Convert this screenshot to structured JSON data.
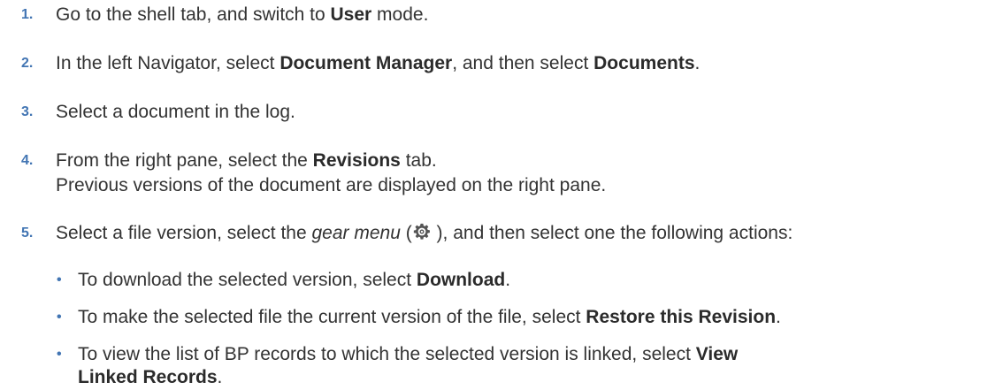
{
  "steps": [
    {
      "num": "1.",
      "p1": "Go to the shell tab, and switch to ",
      "b1": "User",
      "p2": " mode."
    },
    {
      "num": "2.",
      "p1": "In the left Navigator, select ",
      "b1": "Document Manager",
      "p2": ", and then select ",
      "b2": "Documents",
      "p3": "."
    },
    {
      "num": "3.",
      "p1": "Select a document in the log."
    },
    {
      "num": "4.",
      "p1": "From the right pane, select the ",
      "b1": "Revisions",
      "p2": " tab.",
      "line2": "Previous versions of the document are displayed on the right pane."
    },
    {
      "num": "5.",
      "p1": "Select a file version, select the ",
      "i1": "gear menu",
      "p2": " (",
      "p3": " ), and then select one the following actions:"
    }
  ],
  "bullets": [
    {
      "dot": "•",
      "p1": "To download the selected version, select ",
      "b1": "Download",
      "p2": "."
    },
    {
      "dot": "•",
      "p1": "To make the selected file the current version of the file, select ",
      "b1": "Restore this Revision",
      "p2": "."
    },
    {
      "dot": "•",
      "p1": "To view the list of BP records to which the selected version is linked, select ",
      "b1": "View",
      "line2b": "Linked Records",
      "line2p": "."
    }
  ],
  "icons": {
    "gear": "gear-icon"
  },
  "colors": {
    "number": "#4275b3",
    "text": "#333333"
  }
}
